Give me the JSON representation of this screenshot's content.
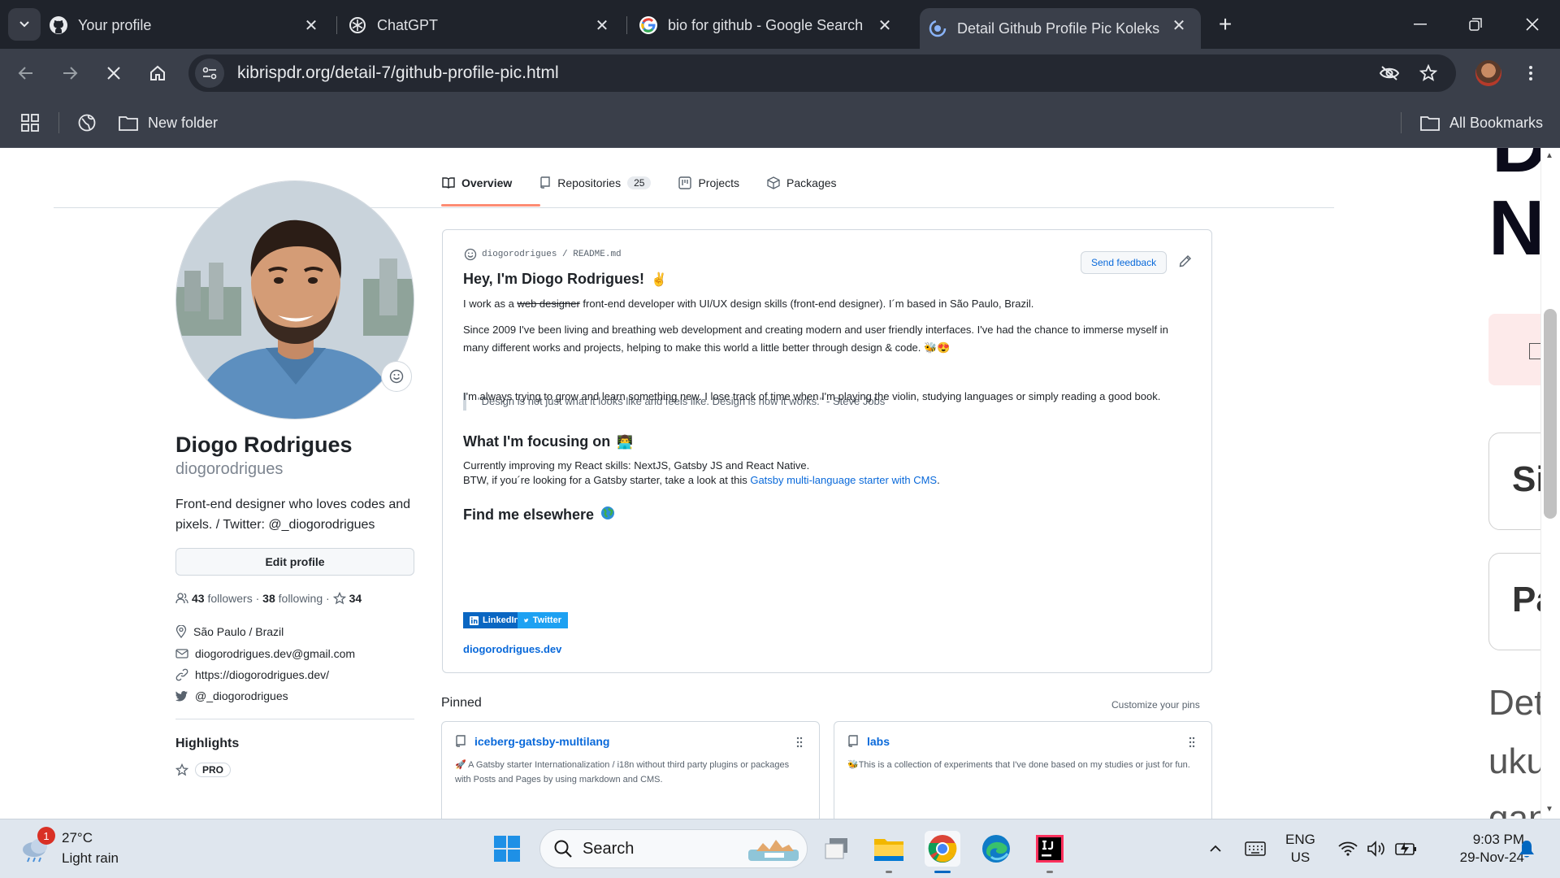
{
  "browser": {
    "tabs": [
      {
        "title": "Your profile",
        "icon": "github-icon"
      },
      {
        "title": "ChatGPT",
        "icon": "chatgpt-icon"
      },
      {
        "title": "bio for github - Google Search",
        "icon": "google-icon"
      },
      {
        "title": "Detail Github Profile Pic Koleksi",
        "icon": "loading-icon",
        "active": true
      }
    ],
    "url": "kibrispdr.org/detail-7/github-profile-pic.html",
    "bookmarks": {
      "folder": "New folder",
      "all": "All Bookmarks"
    }
  },
  "profile": {
    "tabs": [
      {
        "label": "Overview"
      },
      {
        "label": "Repositories",
        "count": "25"
      },
      {
        "label": "Projects"
      },
      {
        "label": "Packages"
      }
    ],
    "name": "Diogo Rodrigues",
    "username": "diogorodrigues",
    "bio": "Front-end designer who loves codes and pixels. / Twitter: @_diogorodrigues",
    "edit_label": "Edit profile",
    "followers_count": "43",
    "followers_label": "followers",
    "following_count": "38",
    "following_label": "following",
    "stars": "34",
    "location": "São Paulo / Brazil",
    "email": "diogorodrigues.dev@gmail.com",
    "website": "https://diogorodrigues.dev/",
    "twitter": "@_diogorodrigues",
    "highlights_title": "Highlights",
    "pro_label": "PRO"
  },
  "readme": {
    "path_user": "diogorodrigues",
    "path_sep": " / ",
    "path_file": "README.md",
    "feedback": "Send feedback",
    "h1": "Hey, I'm Diogo Rodrigues!",
    "h1_emoji": "✌",
    "p1_a": "I work as a ",
    "p1_strike": "web designer",
    "p1_b": " front-end developer with UI/UX design skills (front-end designer). I´m based in São Paulo, Brazil.",
    "p2": "Since 2009 I've been living and breathing web development and creating modern and user friendly interfaces. I've had the chance to immerse myself in many different works and projects, helping to make this world a little better through design & code. 🐝😍",
    "quote": "\"Design is not just what it looks like and feels like. Design is how it works.\" - Steve Jobs",
    "p3": "I'm always trying to grow and learn something new. I lose track of time when I'm playing the violin, studying languages or simply reading a good book.",
    "h2": "What I'm focusing on",
    "h2_emoji": "👨‍💻",
    "p4a": "Currently improving my React skills: NextJS, Gatsby JS and React Native.",
    "p4b": "BTW, if you´re looking for a Gatsby starter, take a look at this ",
    "p4_link": "Gatsby multi-language starter with CMS",
    "p4_end": ".",
    "h3": "Find me elsewhere",
    "h3_emoji": "🌎",
    "linkedin": "LinkedIn",
    "twitter_btn": "Twitter",
    "site": "diogorodrigues.dev"
  },
  "pinned": {
    "title": "Pinned",
    "customize": "Customize your pins",
    "items": [
      {
        "name": "iceberg-gatsby-multilang",
        "desc": "🚀 A Gatsby starter Internationalization / i18n without third party plugins or packages with Posts and Pages by using markdown and CMS."
      },
      {
        "name": "labs",
        "desc": "🐝This is a collection of experiments that I've done based on my studies or just for fun."
      }
    ]
  },
  "right_page": {
    "letter_top": "D",
    "letter": "N",
    "card1": "Si",
    "card2": "Pa",
    "text1": "Det",
    "text2": "uku",
    "text3": "gan"
  },
  "taskbar": {
    "weather_temp": "27°C",
    "weather_desc": "Light rain",
    "weather_badge": "1",
    "search": "Search",
    "lang1": "ENG",
    "lang2": "US",
    "time": "9:03 PM",
    "date": "29-Nov-24"
  },
  "colors": {
    "chrome_dark": "#1f232b",
    "chrome_toolbar": "#3a3f4a",
    "link_blue": "#0969da",
    "tab_underline": "#fd8c73",
    "taskbar": "#dfe6ee"
  }
}
